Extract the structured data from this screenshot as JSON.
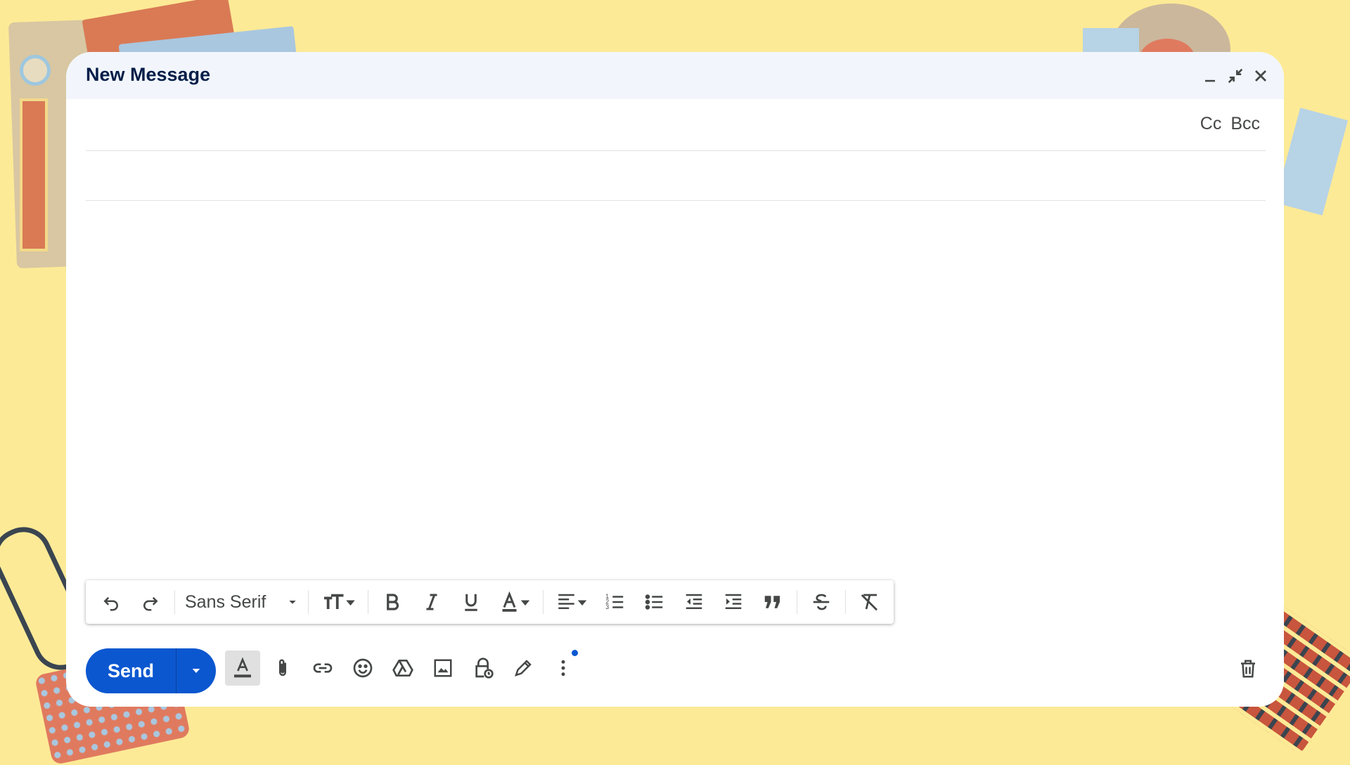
{
  "colors": {
    "accent": "#0b57d0",
    "background": "#fdea96",
    "header_bg": "#f2f6fc",
    "title": "#041e49"
  },
  "compose": {
    "title": "New Message",
    "header_icons": [
      "minimize-icon",
      "exit-fullscreen-icon",
      "close-icon"
    ],
    "to_field": {
      "value": "",
      "cc_label": "Cc",
      "bcc_label": "Bcc"
    },
    "subject_field": {
      "value": ""
    },
    "body": {
      "value": ""
    }
  },
  "formatting_bar": {
    "font_family": "Sans Serif",
    "icons": [
      "undo-icon",
      "redo-icon",
      "font-family-select",
      "font-size-icon",
      "bold-icon",
      "italic-icon",
      "underline-icon",
      "text-color-icon",
      "align-icon",
      "numbered-list-icon",
      "bulleted-list-icon",
      "indent-less-icon",
      "indent-more-icon",
      "quote-icon",
      "strikethrough-icon",
      "remove-formatting-icon"
    ]
  },
  "bottom_bar": {
    "send_label": "Send",
    "icons": [
      "formatting-options-icon",
      "attach-icon",
      "link-icon",
      "emoji-icon",
      "drive-icon",
      "photo-icon",
      "confidential-mode-icon",
      "signature-icon",
      "more-options-icon",
      "discard-icon"
    ]
  }
}
